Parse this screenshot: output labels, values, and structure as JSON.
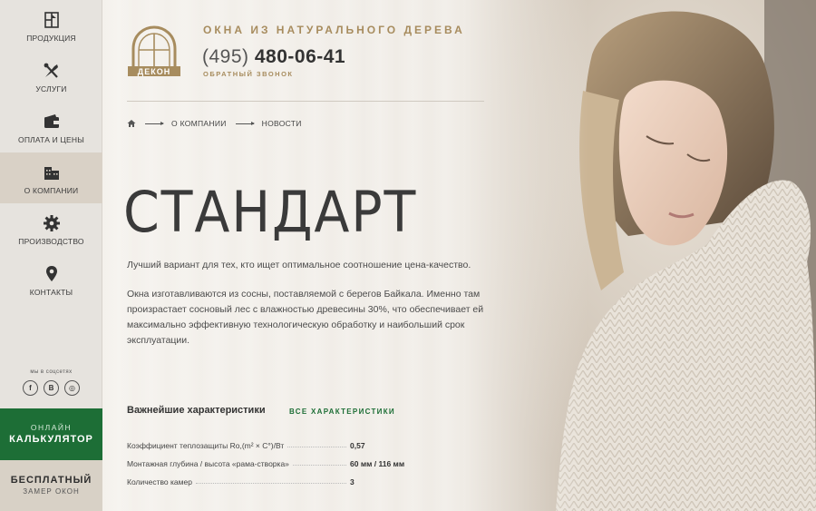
{
  "sidebar": {
    "items": [
      {
        "label": "ПРОДУКЦИЯ",
        "icon": "window-icon"
      },
      {
        "label": "УСЛУГИ",
        "icon": "tools-icon"
      },
      {
        "label": "ОПЛАТА И ЦЕНЫ",
        "icon": "wallet-icon"
      },
      {
        "label": "О КОМПАНИИ",
        "icon": "building-icon",
        "active": true
      },
      {
        "label": "ПРОИЗВОДСТВО",
        "icon": "gear-icon"
      },
      {
        "label": "КОНТАКТЫ",
        "icon": "location-pin-icon"
      }
    ],
    "social_title": "мы в соцсетях",
    "social": [
      {
        "label": "f",
        "icon": "facebook-icon"
      },
      {
        "label": "B",
        "icon": "vk-icon"
      },
      {
        "label": "◎",
        "icon": "instagram-icon"
      }
    ],
    "calc_button": {
      "line1": "онлайн",
      "line2": "КАЛЬКУЛЯТОР"
    },
    "measure_button": {
      "line1": "БЕСПЛАТНЫЙ",
      "line2": "замер окон"
    }
  },
  "header": {
    "logo_text": "ДЕКОН",
    "tagline": "ОКНА ИЗ НАТУРАЛЬНОГО ДЕРЕВА",
    "phone_code": "(495)",
    "phone_number": "480-06-41",
    "callback": "ОБРАТНЫЙ ЗВОНОК"
  },
  "breadcrumb": {
    "items": [
      "О КОМПАНИИ",
      "НОВОСТИ"
    ]
  },
  "main": {
    "title": "СТАНДАРТ",
    "desc1": "Лучший вариант для тех, кто ищет оптимальное соотношение цена-качество.",
    "desc2": "Окна изготавливаются из сосны, поставляемой с берегов Байкала. Именно там произрастает сосновый лес с влажностью древесины 30%, что обеспечивает ей максимально эффективную технологическую обработку и наибольший срок эксплуатации."
  },
  "specs": {
    "title": "Важнейшие характеристики",
    "link": "ВСЕ ХАРАКТЕРИСТИКИ",
    "rows": [
      {
        "name": "Коэффициент теплозащиты Ro,(m² × C°)/Вт",
        "value": "0,57"
      },
      {
        "name": "Монтажная глубина / высота «рама-створка»",
        "value": "60 мм / 116 мм"
      },
      {
        "name": "Количество камер",
        "value": "3"
      }
    ]
  },
  "colors": {
    "accent_green": "#1d6e36",
    "gold": "#a78c5e"
  }
}
